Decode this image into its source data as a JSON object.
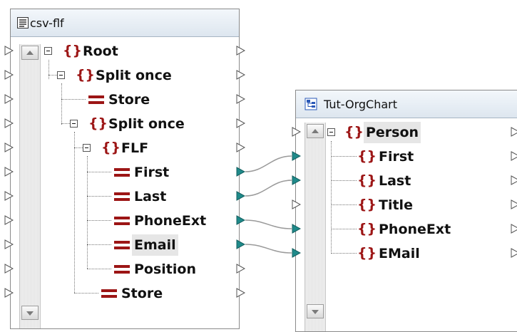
{
  "source_component": {
    "title": "csv-flf",
    "title_icon": "text-file-icon",
    "nodes": [
      {
        "label": "Root",
        "kind": "element"
      },
      {
        "label": "Split once",
        "kind": "element"
      },
      {
        "label": "Store",
        "kind": "attribute"
      },
      {
        "label": "Split once",
        "kind": "element"
      },
      {
        "label": "FLF",
        "kind": "element"
      },
      {
        "label": "First",
        "kind": "attribute"
      },
      {
        "label": "Last",
        "kind": "attribute"
      },
      {
        "label": "PhoneExt",
        "kind": "attribute"
      },
      {
        "label": "Email",
        "kind": "attribute",
        "selected": true
      },
      {
        "label": "Position",
        "kind": "attribute"
      },
      {
        "label": "Store",
        "kind": "attribute"
      }
    ]
  },
  "target_component": {
    "title": "Tut-OrgChart",
    "title_icon": "xml-schema-icon",
    "nodes": [
      {
        "label": "Person",
        "kind": "element",
        "selected": true
      },
      {
        "label": "First",
        "kind": "element"
      },
      {
        "label": "Last",
        "kind": "element"
      },
      {
        "label": "Title",
        "kind": "element"
      },
      {
        "label": "PhoneExt",
        "kind": "element"
      },
      {
        "label": "EMail",
        "kind": "element"
      }
    ]
  },
  "connections": [
    {
      "from": "First",
      "to": "First"
    },
    {
      "from": "Last",
      "to": "Last"
    },
    {
      "from": "PhoneExt",
      "to": "PhoneExt"
    },
    {
      "from": "Email",
      "to": "EMail"
    }
  ],
  "colors": {
    "element_icon": "#9c1515",
    "connected_port": "#1f8a8a",
    "connection_line": "#9a9a9a",
    "title_bar": "#dde6ef"
  }
}
